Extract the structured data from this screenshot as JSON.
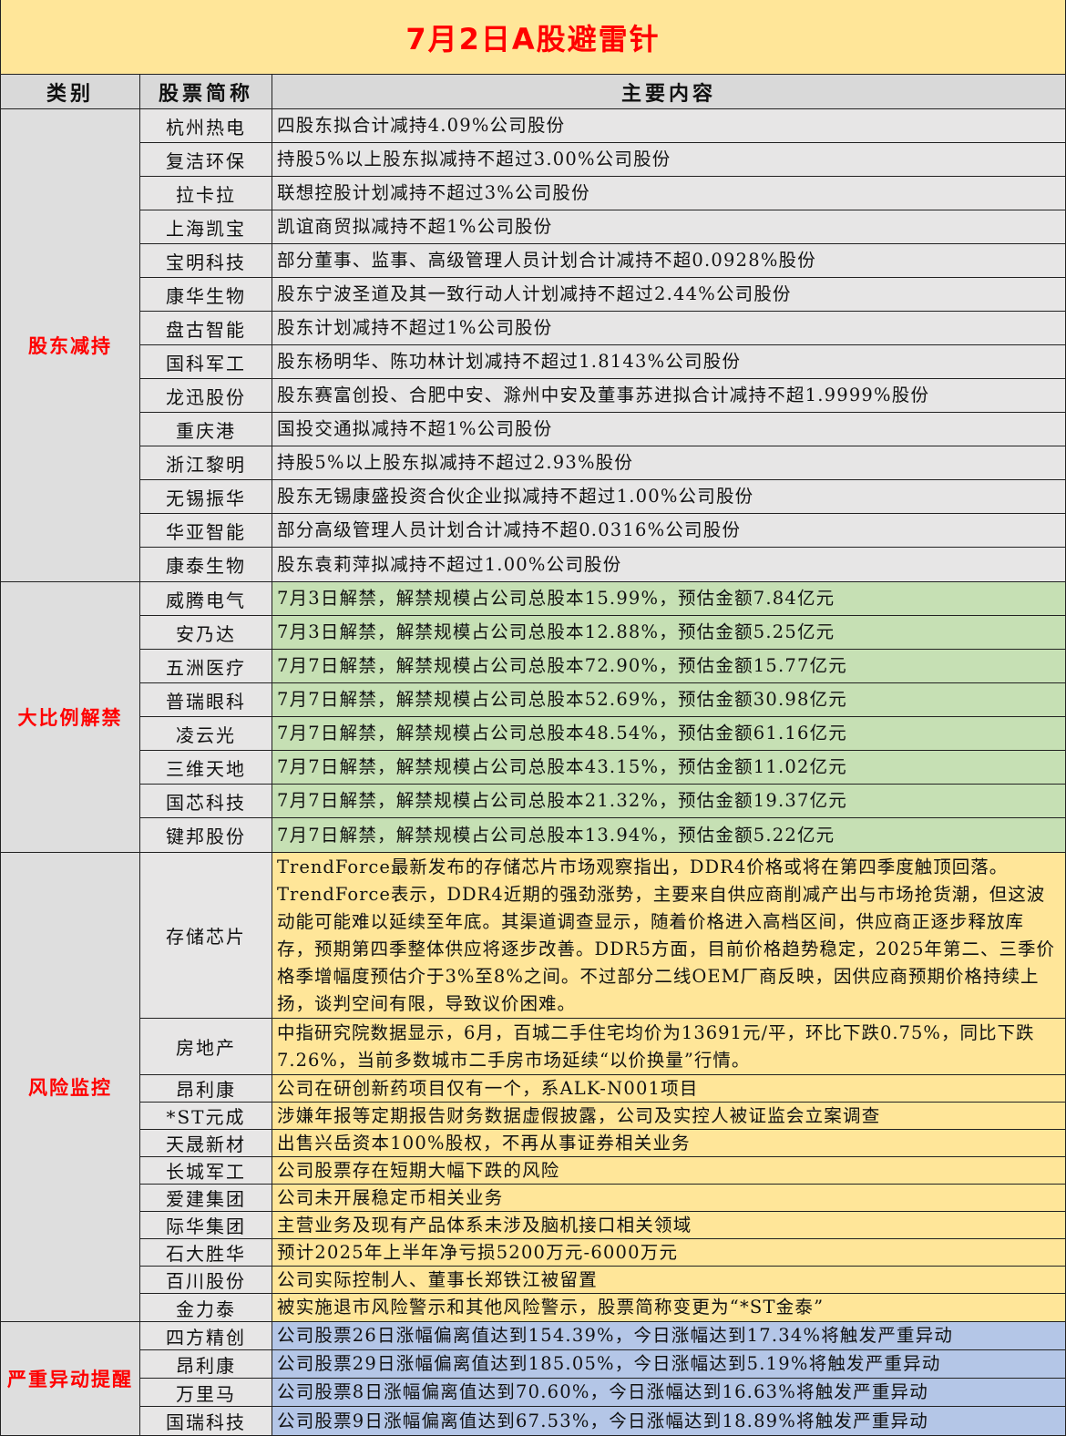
{
  "title": "7月2日A股避雷针",
  "headers": [
    "类别",
    "股票简称",
    "主要内容"
  ],
  "colors": {
    "title_bg": "#FFE699",
    "title_text": "#FF0000",
    "header_bg": "#D9D9D9",
    "reduce_bg": "#E7E6E6",
    "unlock_bg": "#C6E0B4",
    "risk_bg": "#FFE699",
    "abnormal_bg": "#B4C6E7"
  },
  "sections": [
    {
      "category": "股东减持",
      "bg": "#E7E6E6",
      "row_h": 37,
      "rows": [
        {
          "name": "杭州热电",
          "content": "四股东拟合计减持4.09%公司股份"
        },
        {
          "name": "复洁环保",
          "content": "持股5%以上股东拟减持不超过3.00%公司股份"
        },
        {
          "name": "拉卡拉",
          "content": "联想控股计划减持不超过3%公司股份"
        },
        {
          "name": "上海凯宝",
          "content": "凯谊商贸拟减持不超1%公司股份"
        },
        {
          "name": "宝明科技",
          "content": "部分董事、监事、高级管理人员计划合计减持不超0.0928%股份"
        },
        {
          "name": "康华生物",
          "content": "股东宁波圣道及其一致行动人计划减持不超过2.44%公司股份"
        },
        {
          "name": "盘古智能",
          "content": "股东计划减持不超过1%公司股份"
        },
        {
          "name": "国科军工",
          "content": "股东杨明华、陈功林计划减持不超过1.8143%公司股份"
        },
        {
          "name": "龙迅股份",
          "content": "股东赛富创投、合肥中安、滁州中安及董事苏进拟合计减持不超1.9999%股份"
        },
        {
          "name": "重庆港",
          "content": "国投交通拟减持不超1%公司股份"
        },
        {
          "name": "浙江黎明",
          "content": "持股5%以上股东拟减持不超过2.93%股份"
        },
        {
          "name": "无锡振华",
          "content": "股东无锡康盛投资合伙企业拟减持不超过1.00%公司股份"
        },
        {
          "name": "华亚智能",
          "content": "部分高级管理人员计划合计减持不超0.0316%公司股份"
        },
        {
          "name": "康泰生物",
          "content": "股东袁莉萍拟减持不超过1.00%公司股份"
        }
      ]
    },
    {
      "category": "大比例解禁",
      "bg": "#C6E0B4",
      "row_h": 37,
      "rows": [
        {
          "name": "威腾电气",
          "content": "7月3日解禁，解禁规模占公司总股本15.99%，预估金额7.84亿元"
        },
        {
          "name": "安乃达",
          "content": "7月3日解禁，解禁规模占公司总股本12.88%，预估金额5.25亿元"
        },
        {
          "name": "五洲医疗",
          "content": "7月7日解禁，解禁规模占公司总股本72.90%，预估金额15.77亿元"
        },
        {
          "name": "普瑞眼科",
          "content": "7月7日解禁，解禁规模占公司总股本52.69%，预估金额30.98亿元"
        },
        {
          "name": "凌云光",
          "content": "7月7日解禁，解禁规模占公司总股本48.54%，预估金额61.16亿元"
        },
        {
          "name": "三维天地",
          "content": "7月7日解禁，解禁规模占公司总股本43.15%，预估金额11.02亿元"
        },
        {
          "name": "国芯科技",
          "content": "7月7日解禁，解禁规模占公司总股本21.32%，预估金额19.37亿元"
        },
        {
          "name": "键邦股份",
          "content": "7月7日解禁，解禁规模占公司总股本13.94%，预估金额5.22亿元"
        }
      ]
    },
    {
      "category": "风险监控",
      "bg": "#FFE699",
      "row_h": 30,
      "rows": [
        {
          "name": "存储芯片",
          "lines": 6,
          "content": "TrendForce最新发布的存储芯片市场观察指出，DDR4价格或将在第四季度触顶回落。TrendForce表示，DDR4近期的强劲涨势，主要来自供应商削减产出与市场抢货潮，但这波动能可能难以延续至年底。其渠道调查显示，随着价格进入高档区间，供应商正逐步释放库存，预期第四季整体供应将逐步改善。DDR5方面，目前价格趋势稳定，2025年第二、三季价格季增幅度预估介于3%至8%之间。不过部分二线OEM厂商反映，因供应商预期价格持续上扬，谈判空间有限，导致议价困难。"
        },
        {
          "name": "房地产",
          "lines": 2,
          "content": "中指研究院数据显示，6月，百城二手住宅均价为13691元/平，环比下跌0.75%，同比下跌7.26%，当前多数城市二手房市场延续“以价换量”行情。"
        },
        {
          "name": "昂利康",
          "content": "公司在研创新药项目仅有一个，系ALK-N001项目"
        },
        {
          "name": "*ST元成",
          "content": "涉嫌年报等定期报告财务数据虚假披露，公司及实控人被证监会立案调查"
        },
        {
          "name": "天晟新材",
          "content": "出售兴岳资本100%股权，不再从事证券相关业务"
        },
        {
          "name": "长城军工",
          "content": "公司股票存在短期大幅下跌的风险"
        },
        {
          "name": "爱建集团",
          "content": "公司未开展稳定币相关业务"
        },
        {
          "name": "际华集团",
          "content": "主营业务及现有产品体系未涉及脑机接口相关领域"
        },
        {
          "name": "石大胜华",
          "content": "预计2025年上半年净亏损5200万元-6000万元"
        },
        {
          "name": "百川股份",
          "content": "公司实际控制人、董事长郑铁江被留置"
        },
        {
          "name": "金力泰",
          "content": "被实施退市风险警示和其他风险警示，股票简称变更为“*ST金泰”"
        }
      ]
    },
    {
      "category": "严重异动提醒",
      "bg": "#B4C6E7",
      "row_h": 31,
      "rows": [
        {
          "name": "四方精创",
          "content": "公司股票26日涨幅偏离值达到154.39%，今日涨幅达到17.34%将触发严重异动"
        },
        {
          "name": "昂利康",
          "content": "公司股票29日涨幅偏离值达到185.05%，今日涨幅达到5.19%将触发严重异动"
        },
        {
          "name": "万里马",
          "content": "公司股票8日涨幅偏离值达到70.60%，今日涨幅达到16.63%将触发严重异动"
        },
        {
          "name": "国瑞科技",
          "content": "公司股票9日涨幅偏离值达到67.53%，今日涨幅达到18.89%将触发严重异动"
        }
      ]
    }
  ]
}
